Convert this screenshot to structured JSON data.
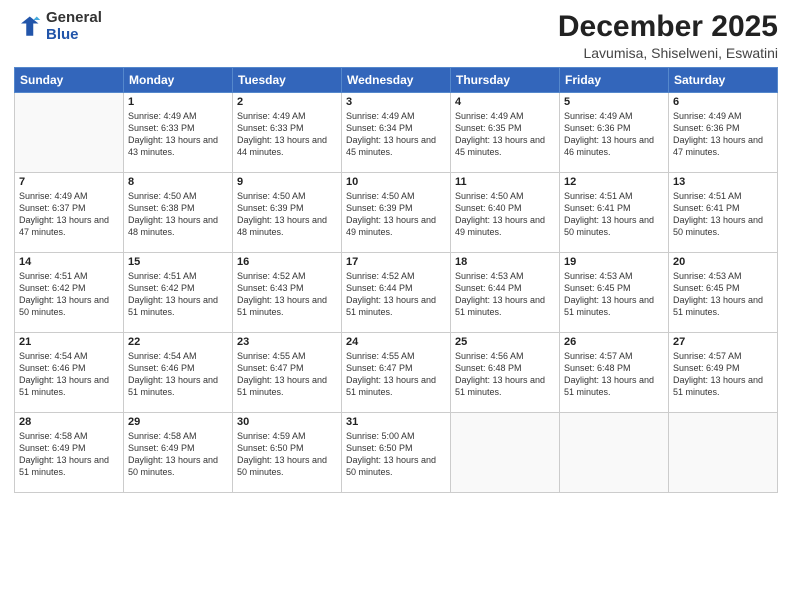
{
  "logo": {
    "general": "General",
    "blue": "Blue"
  },
  "title": "December 2025",
  "location": "Lavumisa, Shiselweni, Eswatini",
  "weekdays": [
    "Sunday",
    "Monday",
    "Tuesday",
    "Wednesday",
    "Thursday",
    "Friday",
    "Saturday"
  ],
  "weeks": [
    [
      {
        "day": "",
        "info": ""
      },
      {
        "day": "1",
        "info": "Sunrise: 4:49 AM\nSunset: 6:33 PM\nDaylight: 13 hours and 43 minutes."
      },
      {
        "day": "2",
        "info": "Sunrise: 4:49 AM\nSunset: 6:33 PM\nDaylight: 13 hours and 44 minutes."
      },
      {
        "day": "3",
        "info": "Sunrise: 4:49 AM\nSunset: 6:34 PM\nDaylight: 13 hours and 45 minutes."
      },
      {
        "day": "4",
        "info": "Sunrise: 4:49 AM\nSunset: 6:35 PM\nDaylight: 13 hours and 45 minutes."
      },
      {
        "day": "5",
        "info": "Sunrise: 4:49 AM\nSunset: 6:36 PM\nDaylight: 13 hours and 46 minutes."
      },
      {
        "day": "6",
        "info": "Sunrise: 4:49 AM\nSunset: 6:36 PM\nDaylight: 13 hours and 47 minutes."
      }
    ],
    [
      {
        "day": "7",
        "info": "Sunrise: 4:49 AM\nSunset: 6:37 PM\nDaylight: 13 hours and 47 minutes."
      },
      {
        "day": "8",
        "info": "Sunrise: 4:50 AM\nSunset: 6:38 PM\nDaylight: 13 hours and 48 minutes."
      },
      {
        "day": "9",
        "info": "Sunrise: 4:50 AM\nSunset: 6:39 PM\nDaylight: 13 hours and 48 minutes."
      },
      {
        "day": "10",
        "info": "Sunrise: 4:50 AM\nSunset: 6:39 PM\nDaylight: 13 hours and 49 minutes."
      },
      {
        "day": "11",
        "info": "Sunrise: 4:50 AM\nSunset: 6:40 PM\nDaylight: 13 hours and 49 minutes."
      },
      {
        "day": "12",
        "info": "Sunrise: 4:51 AM\nSunset: 6:41 PM\nDaylight: 13 hours and 50 minutes."
      },
      {
        "day": "13",
        "info": "Sunrise: 4:51 AM\nSunset: 6:41 PM\nDaylight: 13 hours and 50 minutes."
      }
    ],
    [
      {
        "day": "14",
        "info": "Sunrise: 4:51 AM\nSunset: 6:42 PM\nDaylight: 13 hours and 50 minutes."
      },
      {
        "day": "15",
        "info": "Sunrise: 4:51 AM\nSunset: 6:42 PM\nDaylight: 13 hours and 51 minutes."
      },
      {
        "day": "16",
        "info": "Sunrise: 4:52 AM\nSunset: 6:43 PM\nDaylight: 13 hours and 51 minutes."
      },
      {
        "day": "17",
        "info": "Sunrise: 4:52 AM\nSunset: 6:44 PM\nDaylight: 13 hours and 51 minutes."
      },
      {
        "day": "18",
        "info": "Sunrise: 4:53 AM\nSunset: 6:44 PM\nDaylight: 13 hours and 51 minutes."
      },
      {
        "day": "19",
        "info": "Sunrise: 4:53 AM\nSunset: 6:45 PM\nDaylight: 13 hours and 51 minutes."
      },
      {
        "day": "20",
        "info": "Sunrise: 4:53 AM\nSunset: 6:45 PM\nDaylight: 13 hours and 51 minutes."
      }
    ],
    [
      {
        "day": "21",
        "info": "Sunrise: 4:54 AM\nSunset: 6:46 PM\nDaylight: 13 hours and 51 minutes."
      },
      {
        "day": "22",
        "info": "Sunrise: 4:54 AM\nSunset: 6:46 PM\nDaylight: 13 hours and 51 minutes."
      },
      {
        "day": "23",
        "info": "Sunrise: 4:55 AM\nSunset: 6:47 PM\nDaylight: 13 hours and 51 minutes."
      },
      {
        "day": "24",
        "info": "Sunrise: 4:55 AM\nSunset: 6:47 PM\nDaylight: 13 hours and 51 minutes."
      },
      {
        "day": "25",
        "info": "Sunrise: 4:56 AM\nSunset: 6:48 PM\nDaylight: 13 hours and 51 minutes."
      },
      {
        "day": "26",
        "info": "Sunrise: 4:57 AM\nSunset: 6:48 PM\nDaylight: 13 hours and 51 minutes."
      },
      {
        "day": "27",
        "info": "Sunrise: 4:57 AM\nSunset: 6:49 PM\nDaylight: 13 hours and 51 minutes."
      }
    ],
    [
      {
        "day": "28",
        "info": "Sunrise: 4:58 AM\nSunset: 6:49 PM\nDaylight: 13 hours and 51 minutes."
      },
      {
        "day": "29",
        "info": "Sunrise: 4:58 AM\nSunset: 6:49 PM\nDaylight: 13 hours and 50 minutes."
      },
      {
        "day": "30",
        "info": "Sunrise: 4:59 AM\nSunset: 6:50 PM\nDaylight: 13 hours and 50 minutes."
      },
      {
        "day": "31",
        "info": "Sunrise: 5:00 AM\nSunset: 6:50 PM\nDaylight: 13 hours and 50 minutes."
      },
      {
        "day": "",
        "info": ""
      },
      {
        "day": "",
        "info": ""
      },
      {
        "day": "",
        "info": ""
      }
    ]
  ]
}
